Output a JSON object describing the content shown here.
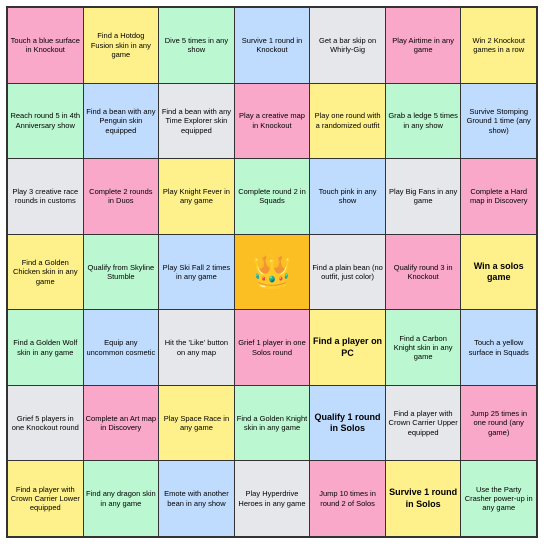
{
  "cells": [
    {
      "id": 0,
      "text": "Touch a blue surface in Knockout",
      "color": "pink"
    },
    {
      "id": 1,
      "text": "Find a Hotdog Fusion skin in any game",
      "color": "yellow"
    },
    {
      "id": 2,
      "text": "Dive 5 times in any show",
      "color": "green"
    },
    {
      "id": 3,
      "text": "Survive 1 round in Knockout",
      "color": "blue"
    },
    {
      "id": 4,
      "text": "Get a bar skip on Whirly-Gig",
      "color": "white"
    },
    {
      "id": 5,
      "text": "Play Airtime in any game",
      "color": "pink"
    },
    {
      "id": 6,
      "text": "Win 2 Knockout games in a row",
      "color": "yellow"
    },
    {
      "id": 7,
      "text": "Reach round 5 in 4th Anniversary show",
      "color": "green"
    },
    {
      "id": 8,
      "text": "Find a bean with any Penguin skin equipped",
      "color": "blue"
    },
    {
      "id": 9,
      "text": "Find a bean with any Time Explorer skin equipped",
      "color": "white"
    },
    {
      "id": 10,
      "text": "Play a creative map in Knockout",
      "color": "pink"
    },
    {
      "id": 11,
      "text": "Play one round with a randomized outfit",
      "color": "yellow"
    },
    {
      "id": 12,
      "text": "Grab a ledge 5 times in any show",
      "color": "green"
    },
    {
      "id": 13,
      "text": "Survive Stomping Ground 1 time (any show)",
      "color": "blue"
    },
    {
      "id": 14,
      "text": "Play 3 creative race rounds in customs",
      "color": "white"
    },
    {
      "id": 15,
      "text": "Complete 2 rounds in Duos",
      "color": "pink"
    },
    {
      "id": 16,
      "text": "Play Knight Fever in any game",
      "color": "yellow"
    },
    {
      "id": 17,
      "text": "Complete round 2 in Squads",
      "color": "green"
    },
    {
      "id": 18,
      "text": "Touch pink in any show",
      "color": "blue"
    },
    {
      "id": 19,
      "text": "Play Big Fans in any game",
      "color": "white"
    },
    {
      "id": 20,
      "text": "Complete a Hard map in Discovery",
      "color": "pink"
    },
    {
      "id": 21,
      "text": "Find a Golden Chicken skin in any game",
      "color": "yellow"
    },
    {
      "id": 22,
      "text": "Qualify from Skyline Stumble",
      "color": "green"
    },
    {
      "id": 23,
      "text": "Play Ski Fall 2 times in any game",
      "color": "blue"
    },
    {
      "id": 24,
      "text": "CROWN",
      "color": "gold"
    },
    {
      "id": 25,
      "text": "Find a plain bean (no outfit, just color)",
      "color": "white"
    },
    {
      "id": 26,
      "text": "Qualify round 3 in Knockout",
      "color": "pink"
    },
    {
      "id": 27,
      "text": "Win a solos game",
      "color": "yellow"
    },
    {
      "id": 28,
      "text": "Find a Golden Wolf skin in any game",
      "color": "green"
    },
    {
      "id": 29,
      "text": "Equip any uncommon cosmetic",
      "color": "blue"
    },
    {
      "id": 30,
      "text": "Hit the 'Like' button on any map",
      "color": "white"
    },
    {
      "id": 31,
      "text": "Grief 1 player in one Solos round",
      "color": "pink"
    },
    {
      "id": 32,
      "text": "Find a player on PC",
      "color": "yellow"
    },
    {
      "id": 33,
      "text": "Find a Carbon Knight skin in any game",
      "color": "green"
    },
    {
      "id": 34,
      "text": "Touch a yellow surface in Squads",
      "color": "blue"
    },
    {
      "id": 35,
      "text": "Grief 5 players in one Knockout round",
      "color": "white"
    },
    {
      "id": 36,
      "text": "Complete an Art map in Discovery",
      "color": "pink"
    },
    {
      "id": 37,
      "text": "Play Space Race in any game",
      "color": "yellow"
    },
    {
      "id": 38,
      "text": "Find a Golden Knight skin in any game",
      "color": "green"
    },
    {
      "id": 39,
      "text": "Qualify 1 round in Solos",
      "color": "blue"
    },
    {
      "id": 40,
      "text": "Find a player with Crown Carrier Upper equipped",
      "color": "white"
    },
    {
      "id": 41,
      "text": "Jump 25 times in one round (any game)",
      "color": "pink"
    },
    {
      "id": 42,
      "text": "Find a player with Crown Carrier Lower equipped",
      "color": "yellow"
    },
    {
      "id": 43,
      "text": "Find any dragon skin in any game",
      "color": "green"
    },
    {
      "id": 44,
      "text": "Emote with another bean in any show",
      "color": "blue"
    },
    {
      "id": 45,
      "text": "Play Hyperdrive Heroes in any game",
      "color": "white"
    },
    {
      "id": 46,
      "text": "Jump 10 times in round 2 of Solos",
      "color": "pink"
    },
    {
      "id": 47,
      "text": "Survive 1 round in Solos",
      "color": "yellow"
    },
    {
      "id": 48,
      "text": "Use the Party Crasher power-up in any game",
      "color": "green"
    }
  ]
}
